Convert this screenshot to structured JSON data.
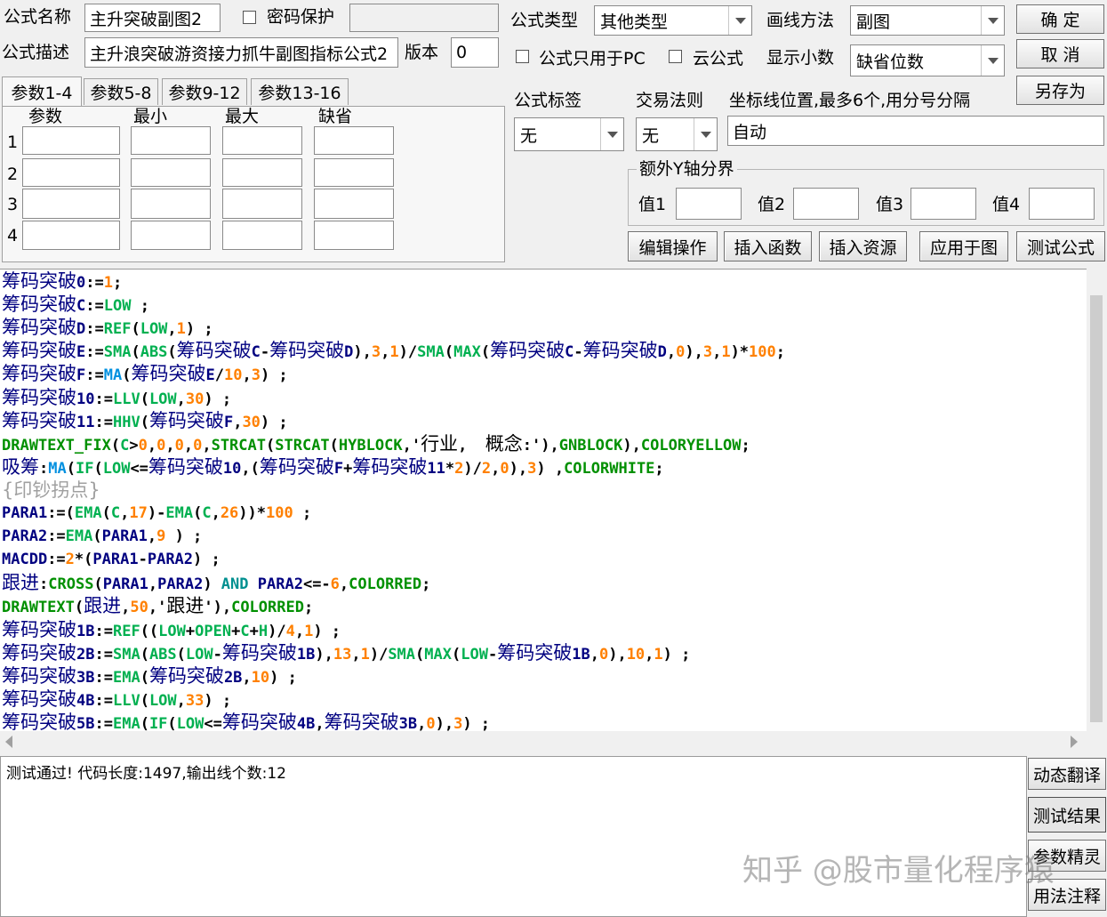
{
  "header": {
    "name_label": "公式名称",
    "name_value": "主升突破副图2",
    "password_label": "密码保护",
    "password_value": "",
    "desc_label": "公式描述",
    "desc_value": "主升浪突破游资接力抓牛副图指标公式2",
    "version_label": "版本",
    "version_value": "0",
    "type_label": "公式类型",
    "type_value": "其他类型",
    "draw_label": "画线方法",
    "draw_value": "副图",
    "pc_only_label": "公式只用于PC",
    "cloud_label": "云公式",
    "decimals_label": "显示小数",
    "decimals_value": "缺省位数",
    "ok_button": "确  定",
    "cancel_button": "取  消",
    "saveas_button": "另存为"
  },
  "tabs": [
    "参数1-4",
    "参数5-8",
    "参数9-12",
    "参数13-16"
  ],
  "params": {
    "headers": [
      "参数",
      "最小",
      "最大",
      "缺省"
    ],
    "rows": [
      "1",
      "2",
      "3",
      "4"
    ]
  },
  "tags": {
    "tag_label": "公式标签",
    "tag_value": "无",
    "rule_label": "交易法则",
    "rule_value": "无",
    "axis_label": "坐标线位置,最多6个,用分号分隔",
    "axis_value": "自动"
  },
  "yaxis": {
    "title": "额外Y轴分界",
    "v1": "值1",
    "v2": "值2",
    "v3": "值3",
    "v4": "值4"
  },
  "actions": [
    "编辑操作",
    "插入函数",
    "插入资源",
    "应用于图",
    "测试公式"
  ],
  "output": {
    "status": "测试通过! 代码长度:1497,输出线个数:12"
  },
  "side_buttons": [
    "动态翻译",
    "测试结果",
    "参数精灵",
    "用法注释"
  ],
  "watermark": "知乎 @股市量化程序猿",
  "code_lines": [
    [
      [
        "v",
        "筹码突破0"
      ],
      [
        "o",
        ":="
      ],
      [
        "n",
        "1"
      ],
      [
        "o",
        ";"
      ]
    ],
    [
      [
        "v",
        "筹码突破C"
      ],
      [
        "o",
        ":="
      ],
      [
        "f",
        "LOW"
      ],
      [
        "o",
        " ;"
      ]
    ],
    [
      [
        "v",
        "筹码突破D"
      ],
      [
        "o",
        ":="
      ],
      [
        "f",
        "REF"
      ],
      [
        "o",
        "("
      ],
      [
        "f",
        "LOW"
      ],
      [
        "o",
        ","
      ],
      [
        "n",
        "1"
      ],
      [
        "o",
        ") ;"
      ]
    ],
    [
      [
        "v",
        "筹码突破E"
      ],
      [
        "o",
        ":="
      ],
      [
        "f",
        "SMA"
      ],
      [
        "o",
        "("
      ],
      [
        "f",
        "ABS"
      ],
      [
        "o",
        "("
      ],
      [
        "v",
        "筹码突破C"
      ],
      [
        "o",
        "-"
      ],
      [
        "v",
        "筹码突破D"
      ],
      [
        "o",
        "),"
      ],
      [
        "n",
        "3"
      ],
      [
        "o",
        ","
      ],
      [
        "n",
        "1"
      ],
      [
        "o",
        ")/"
      ],
      [
        "f",
        "SMA"
      ],
      [
        "o",
        "("
      ],
      [
        "f",
        "MAX"
      ],
      [
        "o",
        "("
      ],
      [
        "v",
        "筹码突破C"
      ],
      [
        "o",
        "-"
      ],
      [
        "v",
        "筹码突破D"
      ],
      [
        "o",
        ","
      ],
      [
        "n",
        "0"
      ],
      [
        "o",
        "),"
      ],
      [
        "n",
        "3"
      ],
      [
        "o",
        ","
      ],
      [
        "n",
        "1"
      ],
      [
        "o",
        ")*"
      ],
      [
        "n",
        "100"
      ],
      [
        "o",
        ";"
      ]
    ],
    [
      [
        "v",
        "筹码突破F"
      ],
      [
        "o",
        ":="
      ],
      [
        "b",
        "MA"
      ],
      [
        "o",
        "("
      ],
      [
        "v",
        "筹码突破E"
      ],
      [
        "o",
        "/"
      ],
      [
        "n",
        "10"
      ],
      [
        "o",
        ","
      ],
      [
        "n",
        "3"
      ],
      [
        "o",
        ") ;"
      ]
    ],
    [
      [
        "v",
        "筹码突破10"
      ],
      [
        "o",
        ":="
      ],
      [
        "f",
        "LLV"
      ],
      [
        "o",
        "("
      ],
      [
        "f",
        "LOW"
      ],
      [
        "o",
        ","
      ],
      [
        "n",
        "30"
      ],
      [
        "o",
        ") ;"
      ]
    ],
    [
      [
        "v",
        "筹码突破11"
      ],
      [
        "o",
        ":="
      ],
      [
        "f",
        "HHV"
      ],
      [
        "o",
        "("
      ],
      [
        "v",
        "筹码突破F"
      ],
      [
        "o",
        ","
      ],
      [
        "n",
        "30"
      ],
      [
        "o",
        ") ;"
      ]
    ],
    [
      [
        "c",
        "DRAWTEXT_FIX"
      ],
      [
        "o",
        "("
      ],
      [
        "f",
        "C"
      ],
      [
        "o",
        ">"
      ],
      [
        "n",
        "0"
      ],
      [
        "o",
        ","
      ],
      [
        "n",
        "0"
      ],
      [
        "o",
        ","
      ],
      [
        "n",
        "0"
      ],
      [
        "o",
        ","
      ],
      [
        "n",
        "0"
      ],
      [
        "o",
        ","
      ],
      [
        "c",
        "STRCAT"
      ],
      [
        "o",
        "("
      ],
      [
        "c",
        "STRCAT"
      ],
      [
        "o",
        "("
      ],
      [
        "c",
        "HYBLOCK"
      ],
      [
        "o",
        ",'行业,  概念:'),"
      ],
      [
        "c",
        "GNBLOCK"
      ],
      [
        "o",
        "),"
      ],
      [
        "c",
        "COLORYELLOW"
      ],
      [
        "o",
        ";"
      ]
    ],
    [
      [
        "v",
        "吸筹"
      ],
      [
        "o",
        ":"
      ],
      [
        "b",
        "MA"
      ],
      [
        "o",
        "("
      ],
      [
        "f",
        "IF"
      ],
      [
        "o",
        "("
      ],
      [
        "f",
        "LOW"
      ],
      [
        "o",
        "<="
      ],
      [
        "v",
        "筹码突破10"
      ],
      [
        "o",
        ",("
      ],
      [
        "v",
        "筹码突破F"
      ],
      [
        "o",
        "+"
      ],
      [
        "v",
        "筹码突破11"
      ],
      [
        "o",
        "*"
      ],
      [
        "n",
        "2"
      ],
      [
        "o",
        ")/"
      ],
      [
        "n",
        "2"
      ],
      [
        "o",
        ","
      ],
      [
        "n",
        "0"
      ],
      [
        "o",
        "),"
      ],
      [
        "n",
        "3"
      ],
      [
        "o",
        ") ,"
      ],
      [
        "c",
        "COLORWHITE"
      ],
      [
        "o",
        ";"
      ]
    ],
    [
      [
        "cm",
        "{印钞拐点}"
      ]
    ],
    [
      [
        "v",
        "PARA1"
      ],
      [
        "o",
        ":=("
      ],
      [
        "f",
        "EMA"
      ],
      [
        "o",
        "("
      ],
      [
        "f",
        "C"
      ],
      [
        "o",
        ","
      ],
      [
        "n",
        "17"
      ],
      [
        "o",
        ")-"
      ],
      [
        "f",
        "EMA"
      ],
      [
        "o",
        "("
      ],
      [
        "f",
        "C"
      ],
      [
        "o",
        ","
      ],
      [
        "n",
        "26"
      ],
      [
        "o",
        "))*"
      ],
      [
        "n",
        "100"
      ],
      [
        "o",
        " ;"
      ]
    ],
    [
      [
        "v",
        "PARA2"
      ],
      [
        "o",
        ":="
      ],
      [
        "f",
        "EMA"
      ],
      [
        "o",
        "("
      ],
      [
        "v",
        "PARA1"
      ],
      [
        "o",
        ","
      ],
      [
        "n",
        "9"
      ],
      [
        "o",
        " ) ;"
      ]
    ],
    [
      [
        "v",
        "MACDD"
      ],
      [
        "o",
        ":="
      ],
      [
        "n",
        "2"
      ],
      [
        "o",
        "*("
      ],
      [
        "v",
        "PARA1"
      ],
      [
        "o",
        "-"
      ],
      [
        "v",
        "PARA2"
      ],
      [
        "o",
        ") ;"
      ]
    ],
    [
      [
        "v",
        "跟进"
      ],
      [
        "o",
        ":"
      ],
      [
        "c",
        "CROSS"
      ],
      [
        "o",
        "("
      ],
      [
        "v",
        "PARA1"
      ],
      [
        "o",
        ","
      ],
      [
        "v",
        "PARA2"
      ],
      [
        "o",
        ") "
      ],
      [
        "k",
        "AND"
      ],
      [
        "o",
        " "
      ],
      [
        "v",
        "PARA2"
      ],
      [
        "o",
        "<=-"
      ],
      [
        "n",
        "6"
      ],
      [
        "o",
        ","
      ],
      [
        "c",
        "COLORRED"
      ],
      [
        "o",
        ";"
      ]
    ],
    [
      [
        "c",
        "DRAWTEXT"
      ],
      [
        "o",
        "("
      ],
      [
        "v",
        "跟进"
      ],
      [
        "o",
        ","
      ],
      [
        "n",
        "50"
      ],
      [
        "o",
        ",'跟进'),"
      ],
      [
        "c",
        "COLORRED"
      ],
      [
        "o",
        ";"
      ]
    ],
    [
      [
        "v",
        "筹码突破1B"
      ],
      [
        "o",
        ":="
      ],
      [
        "f",
        "REF"
      ],
      [
        "o",
        "(("
      ],
      [
        "f",
        "LOW"
      ],
      [
        "o",
        "+"
      ],
      [
        "f",
        "OPEN"
      ],
      [
        "o",
        "+"
      ],
      [
        "f",
        "C"
      ],
      [
        "o",
        "+"
      ],
      [
        "f",
        "H"
      ],
      [
        "o",
        ")/"
      ],
      [
        "n",
        "4"
      ],
      [
        "o",
        ","
      ],
      [
        "n",
        "1"
      ],
      [
        "o",
        ") ;"
      ]
    ],
    [
      [
        "v",
        "筹码突破2B"
      ],
      [
        "o",
        ":="
      ],
      [
        "f",
        "SMA"
      ],
      [
        "o",
        "("
      ],
      [
        "f",
        "ABS"
      ],
      [
        "o",
        "("
      ],
      [
        "f",
        "LOW"
      ],
      [
        "o",
        "-"
      ],
      [
        "v",
        "筹码突破1B"
      ],
      [
        "o",
        "),"
      ],
      [
        "n",
        "13"
      ],
      [
        "o",
        ","
      ],
      [
        "n",
        "1"
      ],
      [
        "o",
        ")/"
      ],
      [
        "f",
        "SMA"
      ],
      [
        "o",
        "("
      ],
      [
        "f",
        "MAX"
      ],
      [
        "o",
        "("
      ],
      [
        "f",
        "LOW"
      ],
      [
        "o",
        "-"
      ],
      [
        "v",
        "筹码突破1B"
      ],
      [
        "o",
        ","
      ],
      [
        "n",
        "0"
      ],
      [
        "o",
        "),"
      ],
      [
        "n",
        "10"
      ],
      [
        "o",
        ","
      ],
      [
        "n",
        "1"
      ],
      [
        "o",
        ") ;"
      ]
    ],
    [
      [
        "v",
        "筹码突破3B"
      ],
      [
        "o",
        ":="
      ],
      [
        "f",
        "EMA"
      ],
      [
        "o",
        "("
      ],
      [
        "v",
        "筹码突破2B"
      ],
      [
        "o",
        ","
      ],
      [
        "n",
        "10"
      ],
      [
        "o",
        ") ;"
      ]
    ],
    [
      [
        "v",
        "筹码突破4B"
      ],
      [
        "o",
        ":="
      ],
      [
        "f",
        "LLV"
      ],
      [
        "o",
        "("
      ],
      [
        "f",
        "LOW"
      ],
      [
        "o",
        ","
      ],
      [
        "n",
        "33"
      ],
      [
        "o",
        ") ;"
      ]
    ],
    [
      [
        "v",
        "筹码突破5B"
      ],
      [
        "o",
        ":="
      ],
      [
        "f",
        "EMA"
      ],
      [
        "o",
        "("
      ],
      [
        "f",
        "IF"
      ],
      [
        "o",
        "("
      ],
      [
        "f",
        "LOW"
      ],
      [
        "o",
        "<="
      ],
      [
        "v",
        "筹码突破4B"
      ],
      [
        "o",
        ","
      ],
      [
        "v",
        "筹码突破3B"
      ],
      [
        "o",
        ","
      ],
      [
        "n",
        "0"
      ],
      [
        "o",
        "),"
      ],
      [
        "n",
        "3"
      ],
      [
        "o",
        ") ;"
      ]
    ]
  ]
}
